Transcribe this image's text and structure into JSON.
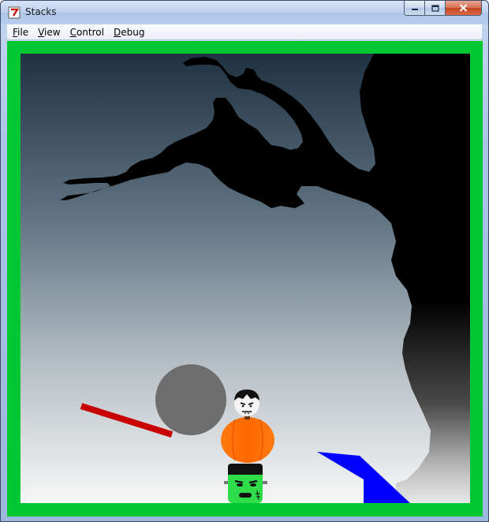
{
  "window": {
    "title": "Stacks",
    "icon": "app-icon",
    "buttons": [
      "minimize-icon",
      "maximize-icon",
      "close-icon"
    ]
  },
  "menu": {
    "items": [
      "File",
      "View",
      "Control",
      "Debug"
    ]
  },
  "scene": {
    "frame_color": "#00c833",
    "sky_top_color": "#1e3040",
    "sky_bottom_color": "#f6f6f6",
    "tree_color": "#000000",
    "objects": [
      {
        "name": "tree-silhouette",
        "color": "#000000"
      },
      {
        "name": "gray-boulder",
        "color": "#6e6e6e"
      },
      {
        "name": "red-plank",
        "color": "#c80000"
      },
      {
        "name": "pumpkin",
        "color": "#ff6a00"
      },
      {
        "name": "vampire-head",
        "color": "#ffffff"
      },
      {
        "name": "frankenstein-head",
        "color": "#2fdc4a"
      },
      {
        "name": "blue-ramp",
        "color": "#0000ff"
      }
    ]
  }
}
